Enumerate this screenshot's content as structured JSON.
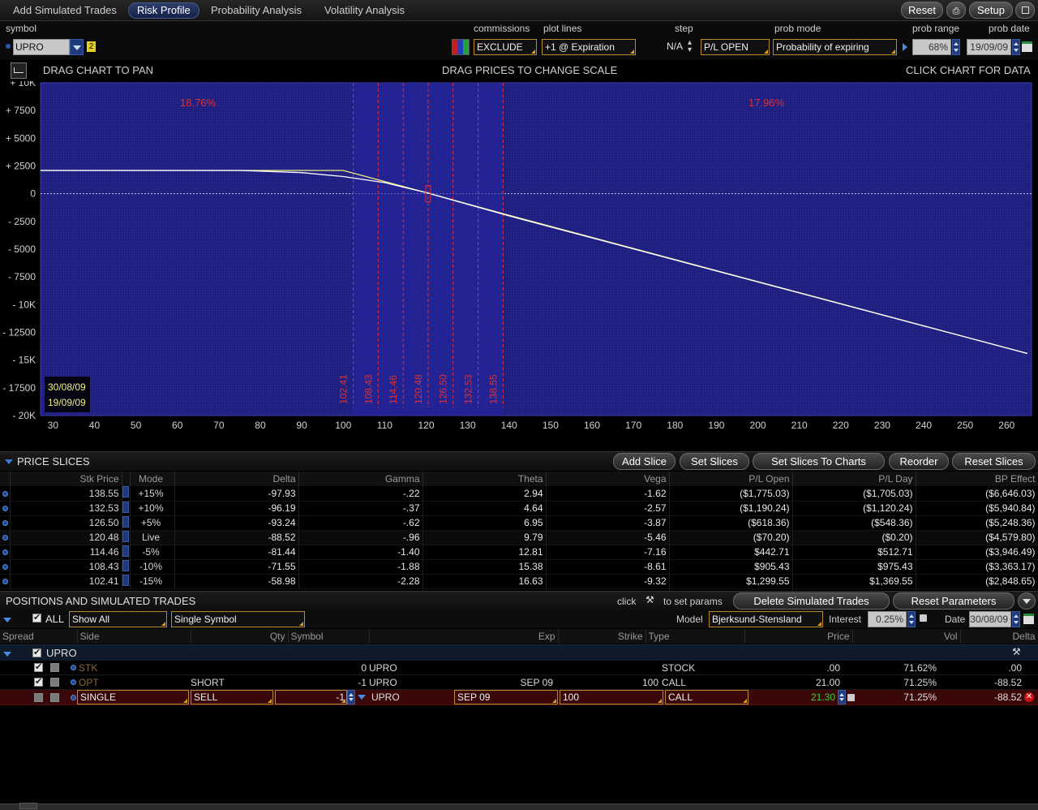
{
  "tabs": {
    "add_trades": "Add Simulated Trades",
    "risk_profile": "Risk Profile",
    "probability": "Probability Analysis",
    "volatility": "Volatility Analysis"
  },
  "toolbar": {
    "reset": "Reset",
    "setup": "Setup"
  },
  "controls": {
    "symbol_label": "symbol",
    "symbol_value": "UPRO",
    "symbol_badge": "2",
    "commissions_label": "commissions",
    "commissions_value": "EXCLUDE",
    "plot_lines_label": "plot lines",
    "plot_lines_value": "+1 @ Expiration",
    "step_label": "step",
    "step_value": "N/A",
    "step_mode": "P/L OPEN",
    "prob_mode_label": "prob mode",
    "prob_mode_value": "Probability of expiring",
    "prob_range_label": "prob range",
    "prob_range_value": "68%",
    "prob_date_label": "prob date",
    "prob_date_value": "19/09/09"
  },
  "chart_header": {
    "left": "DRAG CHART TO PAN",
    "center": "DRAG PRICES TO CHANGE SCALE",
    "right": "CLICK CHART FOR DATA"
  },
  "chart_data": {
    "type": "line",
    "xlim": [
      27,
      266
    ],
    "ylim": [
      -20000,
      10000
    ],
    "x_ticks": [
      30,
      40,
      50,
      60,
      70,
      80,
      90,
      100,
      110,
      120,
      130,
      140,
      150,
      160,
      170,
      180,
      190,
      200,
      210,
      220,
      230,
      240,
      250,
      260
    ],
    "y_ticks": [
      {
        "v": 10000,
        "label": "+ 10K"
      },
      {
        "v": 7500,
        "label": "+ 7500"
      },
      {
        "v": 5000,
        "label": "+ 5000"
      },
      {
        "v": 2500,
        "label": "+ 2500"
      },
      {
        "v": 0,
        "label": "0"
      },
      {
        "v": -2500,
        "label": "- 2500"
      },
      {
        "v": -5000,
        "label": "- 5000"
      },
      {
        "v": -7500,
        "label": "- 7500"
      },
      {
        "v": -10000,
        "label": "- 10K"
      },
      {
        "v": -12500,
        "label": "- 12500"
      },
      {
        "v": -15000,
        "label": "- 15K"
      },
      {
        "v": -17500,
        "label": "- 17500"
      },
      {
        "v": -20000,
        "label": "- 20K"
      }
    ],
    "prob_left_label": "18.76%",
    "prob_right_label": "17.96%",
    "slice_prices": [
      102.41,
      108.43,
      114.46,
      120.48,
      126.5,
      132.53,
      138.55
    ],
    "date_today": "30/08/09",
    "date_expiry": "19/09/09",
    "series": [
      {
        "values": [
          [
            27,
            2100
          ],
          [
            100,
            2100
          ],
          [
            120,
            100
          ],
          [
            140,
            -1950
          ],
          [
            265,
            -14400
          ]
        ]
      },
      {
        "values": [
          [
            27,
            2100
          ],
          [
            75,
            2100
          ],
          [
            90,
            1900
          ],
          [
            100,
            1550
          ],
          [
            110,
            1000
          ],
          [
            120,
            100
          ],
          [
            130,
            -950
          ],
          [
            140,
            -2000
          ],
          [
            265,
            -14400
          ]
        ]
      }
    ]
  },
  "price_slices": {
    "title": "PRICE SLICES",
    "buttons": [
      "Add Slice",
      "Set Slices",
      "Set Slices To Charts",
      "Reorder",
      "Reset Slices"
    ],
    "columns": [
      "Stk Price",
      "Mode",
      "Delta",
      "Gamma",
      "Theta",
      "Vega",
      "P/L Open",
      "P/L Day",
      "BP Effect"
    ],
    "rows": [
      [
        "138.55",
        "+15%",
        "-97.93",
        "-.22",
        "2.94",
        "-1.62",
        "($1,775.03)",
        "($1,705.03)",
        "($6,646.03)"
      ],
      [
        "132.53",
        "+10%",
        "-96.19",
        "-.37",
        "4.64",
        "-2.57",
        "($1,190.24)",
        "($1,120.24)",
        "($5,940.84)"
      ],
      [
        "126.50",
        "+5%",
        "-93.24",
        "-.62",
        "6.95",
        "-3.87",
        "($618.36)",
        "($548.36)",
        "($5,248.36)"
      ],
      [
        "120.48",
        "Live",
        "-88.52",
        "-.96",
        "9.79",
        "-5.46",
        "($70.20)",
        "($0.20)",
        "($4,579.80)"
      ],
      [
        "114.46",
        "-5%",
        "-81.44",
        "-1.40",
        "12.81",
        "-7.16",
        "$442.71",
        "$512.71",
        "($3,946.49)"
      ],
      [
        "108.43",
        "-10%",
        "-71.55",
        "-1.88",
        "15.38",
        "-8.61",
        "$905.43",
        "$975.43",
        "($3,363.17)"
      ],
      [
        "102.41",
        "-15%",
        "-58.98",
        "-2.28",
        "16.63",
        "-9.32",
        "$1,299.55",
        "$1,369.55",
        "($2,848.65)"
      ]
    ]
  },
  "positions": {
    "title": "POSITIONS AND SIMULATED TRADES",
    "click_text": "click",
    "set_params_text": "to set params",
    "delete_btn": "Delete Simulated Trades",
    "reset_params_btn": "Reset Parameters",
    "all_label": "ALL",
    "show_value": "Show All",
    "group_value": "Single Symbol",
    "model_label": "Model",
    "model_value": "Bjerksund-Stensland",
    "interest_label": "Interest",
    "interest_value": "0.25%",
    "date_label": "Date",
    "date_value": "30/08/09",
    "columns": [
      "Spread",
      "Side",
      "Qty",
      "Symbol",
      "Exp",
      "Strike",
      "Type",
      "Price",
      "Vol",
      "Delta"
    ],
    "group_name": "UPRO",
    "rows": [
      {
        "spread": "STK",
        "side": "",
        "qty": "0",
        "symbol": "UPRO",
        "exp": "",
        "strike": "",
        "type": "STOCK",
        "price": ".00",
        "vol": "71.62%",
        "delta": ".00"
      },
      {
        "spread": "OPT",
        "side": "SHORT",
        "qty": "-1",
        "symbol": "UPRO",
        "exp": "SEP 09",
        "strike": "100",
        "type": "CALL",
        "price": "21.00",
        "vol": "71.25%",
        "delta": "-88.52"
      }
    ],
    "sim_row": {
      "spread": "SINGLE",
      "side": "SELL",
      "qty": "-1",
      "symbol": "UPRO",
      "exp": "SEP 09",
      "strike": "100",
      "type": "CALL",
      "price": "21.30",
      "vol": "71.25%",
      "delta": "-88.52"
    }
  }
}
